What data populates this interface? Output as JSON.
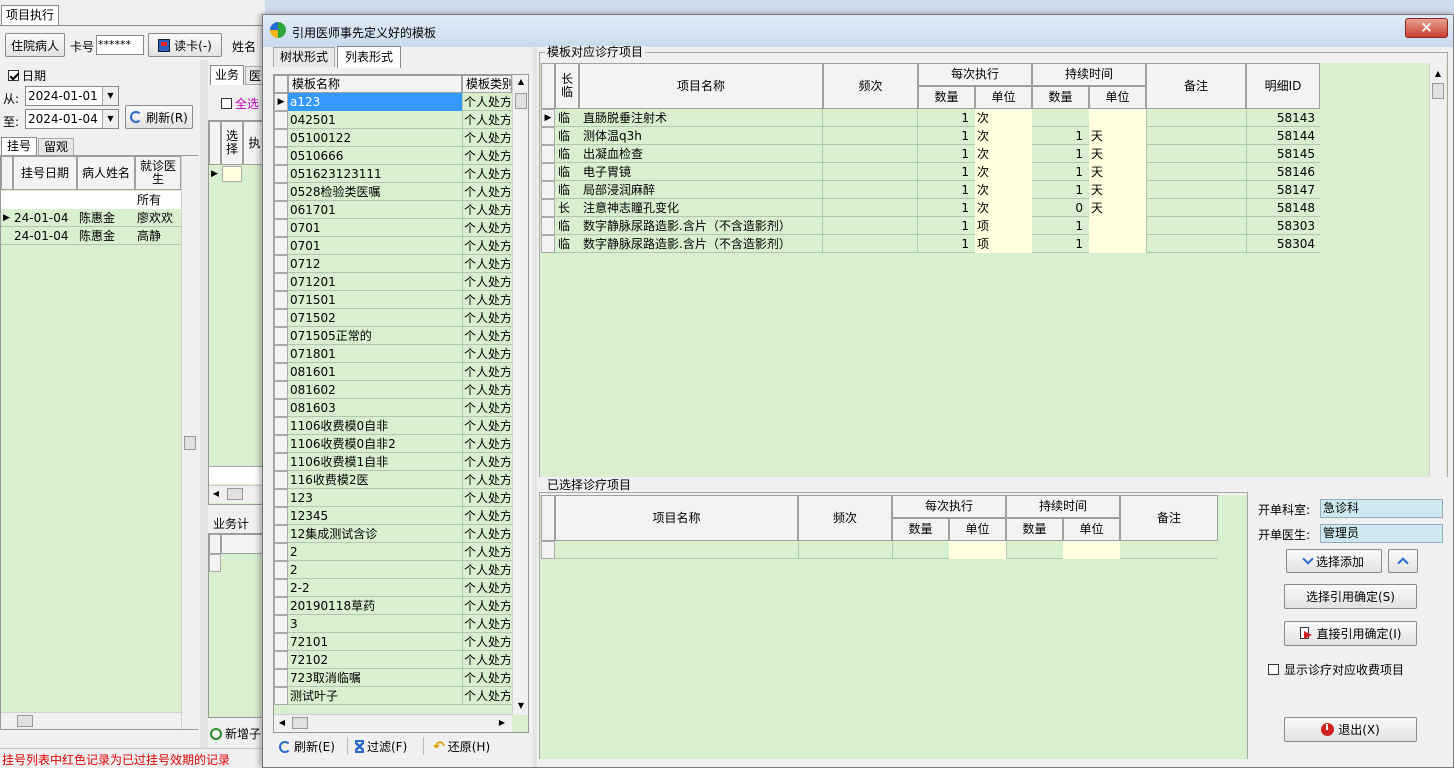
{
  "main": {
    "tab": "项目执行",
    "inpatient_btn": "住院病人",
    "card_label": "卡号",
    "card_value": "******",
    "read_card_btn": "读卡(-)",
    "name_label": "姓名",
    "date_chk_label": "日期",
    "from_label": "从:",
    "from_date": "2024-01-01",
    "to_label": "至:",
    "to_date": "2024-01-04",
    "refresh_btn": "刷新(R)",
    "reg_tabs": [
      "挂号",
      "留观"
    ],
    "reg_cols": [
      "挂号日期",
      "病人姓名",
      "就诊医生"
    ],
    "reg_filter": "所有",
    "reg_rows": [
      {
        "date": "24-01-04",
        "name": "陈惠金",
        "doctor": "廖欢欢"
      },
      {
        "date": "24-01-04",
        "name": "陈惠金",
        "doctor": "高静"
      }
    ],
    "biz_tabs": [
      "业务",
      "医"
    ],
    "select_all": "全选",
    "select_col": "选择",
    "biz_col2": "执",
    "biz_plan": "业务计",
    "new_btn": "新增子",
    "status": "挂号列表中红色记录为已过挂号效期的记录"
  },
  "dialog": {
    "title": "引用医师事先定义好的模板",
    "close": "×",
    "tabs": [
      "树状形式",
      "列表形式"
    ],
    "tpl_cols": [
      "模板名称",
      "模板类别"
    ],
    "tpl_type": "个人处方",
    "tpl_rows": [
      "a123",
      "042501",
      "05100122",
      "0510666",
      "051623123111",
      "0528检验类医嘱",
      "061701",
      "0701",
      "0701",
      "0712",
      "071201",
      "071501",
      "071502",
      "071505正常的",
      "071801",
      "081601",
      "081602",
      "081603",
      "1106收费模0自非",
      "1106收费模0自非2",
      "1106收费模1自非",
      "116收费模2医",
      "123",
      "12345",
      "12集成测试含诊",
      "2",
      "2",
      "2-2",
      "20190118草药",
      "3",
      "72101",
      "72102",
      "723取消临嘱",
      "测试叶子"
    ],
    "bottom_btns": [
      "刷新(E)",
      "过滤(F)",
      "还原(H)"
    ],
    "items_group": "模板对应诊疗项目",
    "items_cols": {
      "long": "长临",
      "name": "项目名称",
      "freq": "频次",
      "each": "每次执行",
      "qty": "数量",
      "unit": "单位",
      "dur": "持续时间",
      "note": "备注",
      "id": "明细ID"
    },
    "items": [
      {
        "t": "临",
        "name": "直肠脱垂注射术",
        "qty": "1",
        "unit": "次",
        "dqty": "",
        "dunit": "",
        "id": "58143"
      },
      {
        "t": "临",
        "name": "测体温q3h",
        "qty": "1",
        "unit": "次",
        "dqty": "1",
        "dunit": "天",
        "id": "58144"
      },
      {
        "t": "临",
        "name": "出凝血检查",
        "qty": "1",
        "unit": "次",
        "dqty": "1",
        "dunit": "天",
        "id": "58145"
      },
      {
        "t": "临",
        "name": "电子胃镜",
        "qty": "1",
        "unit": "次",
        "dqty": "1",
        "dunit": "天",
        "id": "58146"
      },
      {
        "t": "临",
        "name": "局部浸润麻醉",
        "qty": "1",
        "unit": "次",
        "dqty": "1",
        "dunit": "天",
        "id": "58147"
      },
      {
        "t": "长",
        "name": "注意神志瞳孔变化",
        "qty": "1",
        "unit": "次",
        "dqty": "0",
        "dunit": "天",
        "id": "58148"
      },
      {
        "t": "临",
        "name": "数字静脉尿路造影.含片（不含造影剂）",
        "qty": "1",
        "unit": "项",
        "dqty": "1",
        "dunit": "",
        "id": "58303"
      },
      {
        "t": "临",
        "name": "数字静脉尿路造影.含片（不含造影剂）",
        "qty": "1",
        "unit": "项",
        "dqty": "1",
        "dunit": "",
        "id": "58304"
      }
    ],
    "selected_group": "已选择诊疗项目",
    "dept_label": "开单科室:",
    "dept_value": "急诊科",
    "doctor_label": "开单医生:",
    "doctor_value": "管理员",
    "select_add_btn": "选择添加",
    "select_confirm_btn": "选择引用确定(S)",
    "direct_confirm_btn": "直接引用确定(I)",
    "show_fee_chk": "显示诊疗对应收费项目",
    "exit_btn": "退出(X)"
  }
}
